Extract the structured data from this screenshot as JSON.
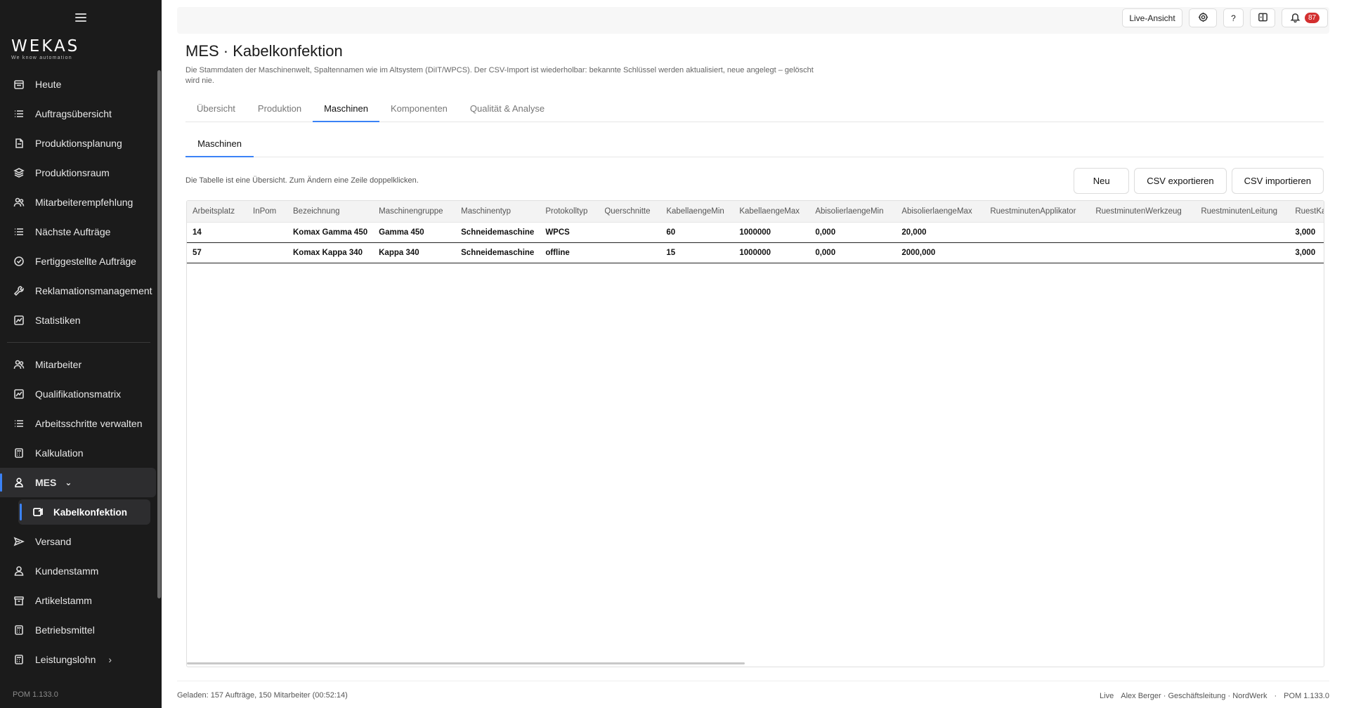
{
  "brand": {
    "logo": "WEKAS",
    "tagline": "We know automation"
  },
  "sidebar": {
    "items": [
      {
        "label": "Heute",
        "icon": "calendar-icon"
      },
      {
        "label": "Auftragsübersicht",
        "icon": "list-icon"
      },
      {
        "label": "Produktionsplanung",
        "icon": "document-icon"
      },
      {
        "label": "Produktionsraum",
        "icon": "layers-icon"
      },
      {
        "label": "Mitarbeiterempfehlung",
        "icon": "users-icon"
      },
      {
        "label": "Nächste Aufträge",
        "icon": "list-icon"
      },
      {
        "label": "Fertiggestellte Aufträge",
        "icon": "check-circle-icon"
      },
      {
        "label": "Reklamationsmanagement",
        "icon": "wrench-icon"
      },
      {
        "label": "Statistiken",
        "icon": "chart-icon"
      }
    ],
    "items2": [
      {
        "label": "Mitarbeiter",
        "icon": "users-icon"
      },
      {
        "label": "Qualifikationsmatrix",
        "icon": "chart-icon"
      },
      {
        "label": "Arbeitsschritte verwalten",
        "icon": "list-icon"
      },
      {
        "label": "Kalkulation",
        "icon": "calculator-icon"
      }
    ],
    "mes": {
      "label": "MES",
      "sub": "Kabelkonfektion"
    },
    "items3": [
      {
        "label": "Versand",
        "icon": "send-icon"
      },
      {
        "label": "Kundenstamm",
        "icon": "user-icon"
      },
      {
        "label": "Artikelstamm",
        "icon": "archive-icon"
      },
      {
        "label": "Betriebsmittel",
        "icon": "calculator-icon"
      },
      {
        "label": "Leistungslohn",
        "icon": "calculator-icon"
      }
    ],
    "version": "POM 1.133.0"
  },
  "topbar": {
    "live_label": "Live-Ansicht",
    "help_label": "?",
    "notif_count": "87"
  },
  "page": {
    "title": "MES · Kabelkonfektion",
    "description": "Die Stammdaten der Maschinenwelt, Spaltennamen wie im Altsystem (DiIT/WPCS). Der CSV-Import ist wiederholbar: bekannte Schlüssel werden aktualisiert, neue angelegt – gelöscht wird nie."
  },
  "tabs": [
    "Übersicht",
    "Produktion",
    "Maschinen",
    "Komponenten",
    "Qualität & Analyse"
  ],
  "subtab": "Maschinen",
  "hint": "Die Tabelle ist eine Übersicht. Zum Ändern eine Zeile doppelklicken.",
  "actions": {
    "new": "Neu",
    "export": "CSV exportieren",
    "import": "CSV importieren"
  },
  "table": {
    "columns": [
      "Arbeitsplatz",
      "InPom",
      "Bezeichnung",
      "Maschinengruppe",
      "Maschinentyp",
      "Protokolltyp",
      "Querschnitte",
      "KabellaengeMin",
      "KabellaengeMax",
      "AbisolierlaengeMin",
      "AbisolierlaengeMax",
      "RuestminutenApplikator",
      "RuestminutenWerkzeug",
      "RuestminutenLeitung",
      "RuestKabel"
    ],
    "rows": [
      [
        "14",
        "",
        "Komax Gamma 450",
        "Gamma 450",
        "Schneidemaschine",
        "WPCS",
        "",
        "60",
        "1000000",
        "0,000",
        "20,000",
        "",
        "",
        "",
        "3,000"
      ],
      [
        "57",
        "",
        "Komax Kappa 340",
        "Kappa 340",
        "Schneidemaschine",
        "offline",
        "",
        "15",
        "1000000",
        "0,000",
        "2000,000",
        "",
        "",
        "",
        "3,000"
      ]
    ]
  },
  "status": {
    "left": "Geladen: 157 Aufträge, 150 Mitarbeiter (00:52:14)",
    "mode": "Live",
    "user": "Alex Berger · Geschäftsleitung · NordWerk",
    "dot": "·",
    "version": "POM 1.133.0"
  }
}
